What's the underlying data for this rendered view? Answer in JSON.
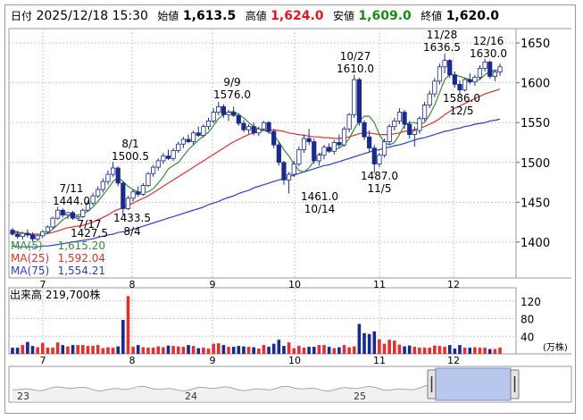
{
  "header": {
    "date_label": "日付",
    "datetime": "2025/12/18 15:30",
    "open_label": "始値",
    "open_value": "1,613.5",
    "high_label": "高値",
    "high_value": "1,624.0",
    "low_label": "安値",
    "low_value": "1,609.0",
    "close_label": "終値",
    "close_value": "1,620.0",
    "colors": {
      "high": "#e8141e",
      "low": "#1a8c1a",
      "text": "#000000"
    }
  },
  "ma_legend": [
    {
      "label": "MA(5)",
      "value": "1,615.20",
      "color": "#3a8a3a"
    },
    {
      "label": "MA(25)",
      "value": "1,592.04",
      "color": "#e03030"
    },
    {
      "label": "MA(75)",
      "value": "1,554.21",
      "color": "#2a3fd0"
    }
  ],
  "volume_label": "出来高",
  "volume_value": "219,700株",
  "volume_unit": "(万株)",
  "range_labels": [
    "23",
    "24",
    "25"
  ],
  "chart_data": {
    "type": "candlestick",
    "price_axis": {
      "ylim": [
        1355,
        1668
      ],
      "ticks": [
        1400,
        1450,
        1500,
        1550,
        1600,
        1650
      ]
    },
    "volume_axis": {
      "ylim": [
        0,
        150
      ],
      "ticks": [
        40,
        80,
        120
      ],
      "unit": "(万株)"
    },
    "month_labels": [
      "7",
      "8",
      "9",
      "10",
      "11",
      "12"
    ],
    "annotations": [
      {
        "date": "7/11",
        "price": "1444.0",
        "kind": "high"
      },
      {
        "date": "7/17",
        "price": "1427.5",
        "kind": "low"
      },
      {
        "date": "8/1",
        "price": "1500.5",
        "kind": "high"
      },
      {
        "date": "8/4",
        "price": "1433.5",
        "kind": "low"
      },
      {
        "date": "9/9",
        "price": "1576.0",
        "kind": "high"
      },
      {
        "date": "10/14",
        "price": "1461.0",
        "kind": "low"
      },
      {
        "date": "10/27",
        "price": "1610.0",
        "kind": "high"
      },
      {
        "date": "11/5",
        "price": "1487.0",
        "kind": "low"
      },
      {
        "date": "11/28",
        "price": "1636.5",
        "kind": "high"
      },
      {
        "date": "12/5",
        "price": "1586.0",
        "kind": "low"
      },
      {
        "date": "12/16",
        "price": "1630.0",
        "kind": "high"
      }
    ],
    "candles": [
      [
        1415,
        1418,
        1408,
        1410
      ],
      [
        1410,
        1414,
        1404,
        1407
      ],
      [
        1407,
        1413,
        1403,
        1411
      ],
      [
        1411,
        1416,
        1406,
        1409
      ],
      [
        1409,
        1412,
        1401,
        1404
      ],
      [
        1404,
        1410,
        1401,
        1408
      ],
      [
        1408,
        1415,
        1405,
        1413
      ],
      [
        1413,
        1421,
        1410,
        1419
      ],
      [
        1419,
        1432,
        1417,
        1430
      ],
      [
        1430,
        1444,
        1428,
        1440
      ],
      [
        1440,
        1442,
        1431,
        1434
      ],
      [
        1434,
        1438,
        1429,
        1437
      ],
      [
        1437,
        1439,
        1428,
        1430
      ],
      [
        1430,
        1433,
        1427.5,
        1432
      ],
      [
        1432,
        1442,
        1430,
        1440
      ],
      [
        1440,
        1452,
        1438,
        1449
      ],
      [
        1449,
        1462,
        1446,
        1458
      ],
      [
        1458,
        1470,
        1455,
        1466
      ],
      [
        1466,
        1480,
        1462,
        1476
      ],
      [
        1476,
        1490,
        1472,
        1485
      ],
      [
        1485,
        1500.5,
        1482,
        1493
      ],
      [
        1493,
        1495,
        1470,
        1474
      ],
      [
        1474,
        1476,
        1433.5,
        1442
      ],
      [
        1442,
        1458,
        1440,
        1455
      ],
      [
        1455,
        1466,
        1451,
        1463
      ],
      [
        1463,
        1470,
        1457,
        1460
      ],
      [
        1460,
        1474,
        1458,
        1471
      ],
      [
        1471,
        1488,
        1469,
        1486
      ],
      [
        1486,
        1497,
        1482,
        1494
      ],
      [
        1494,
        1505,
        1490,
        1502
      ],
      [
        1502,
        1512,
        1498,
        1508
      ],
      [
        1508,
        1516,
        1503,
        1505
      ],
      [
        1505,
        1518,
        1502,
        1515
      ],
      [
        1515,
        1526,
        1512,
        1523
      ],
      [
        1523,
        1532,
        1518,
        1529
      ],
      [
        1529,
        1535,
        1524,
        1526
      ],
      [
        1526,
        1540,
        1522,
        1537
      ],
      [
        1537,
        1545,
        1532,
        1534
      ],
      [
        1534,
        1548,
        1531,
        1545
      ],
      [
        1545,
        1556,
        1541,
        1552
      ],
      [
        1552,
        1568,
        1549,
        1563
      ],
      [
        1563,
        1576,
        1559,
        1570
      ],
      [
        1570,
        1573,
        1556,
        1560
      ],
      [
        1560,
        1566,
        1552,
        1563
      ],
      [
        1563,
        1570,
        1557,
        1559
      ],
      [
        1559,
        1562,
        1546,
        1549
      ],
      [
        1549,
        1553,
        1538,
        1541
      ],
      [
        1541,
        1548,
        1536,
        1545
      ],
      [
        1545,
        1550,
        1534,
        1537
      ],
      [
        1537,
        1545,
        1533,
        1542
      ],
      [
        1542,
        1552,
        1540,
        1550
      ],
      [
        1550,
        1552,
        1536,
        1539
      ],
      [
        1539,
        1542,
        1518,
        1522
      ],
      [
        1522,
        1526,
        1496,
        1500
      ],
      [
        1500,
        1502,
        1472,
        1478
      ],
      [
        1478,
        1488,
        1461,
        1485
      ],
      [
        1485,
        1502,
        1482,
        1498
      ],
      [
        1498,
        1520,
        1495,
        1516
      ],
      [
        1516,
        1535,
        1512,
        1530
      ],
      [
        1530,
        1542,
        1522,
        1526
      ],
      [
        1526,
        1530,
        1498,
        1502
      ],
      [
        1502,
        1512,
        1496,
        1509
      ],
      [
        1509,
        1522,
        1504,
        1519
      ],
      [
        1519,
        1524,
        1512,
        1514
      ],
      [
        1514,
        1528,
        1510,
        1525
      ],
      [
        1525,
        1535,
        1518,
        1522
      ],
      [
        1522,
        1545,
        1520,
        1542
      ],
      [
        1542,
        1562,
        1538,
        1560
      ],
      [
        1560,
        1610,
        1556,
        1604
      ],
      [
        1604,
        1606,
        1546,
        1550
      ],
      [
        1550,
        1553,
        1528,
        1532
      ],
      [
        1532,
        1540,
        1512,
        1518
      ],
      [
        1518,
        1522,
        1487,
        1498
      ],
      [
        1498,
        1512,
        1494,
        1509
      ],
      [
        1509,
        1530,
        1506,
        1526
      ],
      [
        1526,
        1548,
        1522,
        1545
      ],
      [
        1545,
        1556,
        1540,
        1552
      ],
      [
        1552,
        1568,
        1548,
        1563
      ],
      [
        1563,
        1566,
        1542,
        1548
      ],
      [
        1548,
        1552,
        1530,
        1535
      ],
      [
        1535,
        1545,
        1520,
        1540
      ],
      [
        1540,
        1558,
        1536,
        1555
      ],
      [
        1555,
        1576,
        1552,
        1572
      ],
      [
        1572,
        1590,
        1568,
        1586
      ],
      [
        1586,
        1606,
        1582,
        1602
      ],
      [
        1602,
        1624,
        1598,
        1620
      ],
      [
        1620,
        1636.5,
        1612,
        1628
      ],
      [
        1628,
        1630,
        1606,
        1610
      ],
      [
        1610,
        1614,
        1594,
        1598
      ],
      [
        1598,
        1603,
        1586,
        1591
      ],
      [
        1591,
        1606,
        1589,
        1604
      ],
      [
        1604,
        1612,
        1598,
        1601
      ],
      [
        1601,
        1610,
        1596,
        1607
      ],
      [
        1607,
        1622,
        1604,
        1618
      ],
      [
        1618,
        1630,
        1614,
        1626
      ],
      [
        1626,
        1628,
        1605,
        1608
      ],
      [
        1608,
        1616,
        1602,
        1613.5
      ],
      [
        1613.5,
        1624,
        1609,
        1620
      ]
    ],
    "ma5": [
      1414,
      1413,
      1411,
      1410,
      1408,
      1407,
      1409,
      1411,
      1416,
      1422,
      1428,
      1432,
      1434,
      1434,
      1435,
      1439,
      1444,
      1451,
      1459,
      1467,
      1476,
      1481,
      1476,
      1470,
      1466,
      1463,
      1462,
      1463,
      1467,
      1474,
      1482,
      1492,
      1496,
      1500,
      1508,
      1516,
      1522,
      1528,
      1533,
      1538,
      1546,
      1555,
      1560,
      1563,
      1564,
      1560,
      1556,
      1550,
      1545,
      1542,
      1540,
      1538,
      1534,
      1526,
      1516,
      1508,
      1498,
      1490,
      1488,
      1493,
      1502,
      1509,
      1514,
      1516,
      1516,
      1518,
      1522,
      1530,
      1542,
      1552,
      1558,
      1558,
      1550,
      1535,
      1525,
      1522,
      1525,
      1535,
      1547,
      1550,
      1550,
      1548,
      1550,
      1560,
      1572,
      1588,
      1604,
      1610,
      1610,
      1608,
      1606,
      1604,
      1602,
      1604,
      1610,
      1614,
      1616,
      1615.2
    ],
    "ma25": [
      1412,
      1412,
      1411,
      1411,
      1410,
      1410,
      1410,
      1411,
      1412,
      1414,
      1416,
      1418,
      1419,
      1420,
      1421,
      1423,
      1425,
      1428,
      1431,
      1434,
      1438,
      1441,
      1443,
      1446,
      1449,
      1452,
      1455,
      1458,
      1462,
      1466,
      1470,
      1474,
      1478,
      1482,
      1486,
      1490,
      1494,
      1498,
      1502,
      1506,
      1510,
      1514,
      1518,
      1522,
      1526,
      1529,
      1532,
      1535,
      1537,
      1539,
      1540,
      1541,
      1541,
      1540,
      1539,
      1537,
      1536,
      1535,
      1534,
      1533,
      1532,
      1532,
      1531,
      1531,
      1530,
      1530,
      1531,
      1532,
      1534,
      1536,
      1537,
      1537,
      1536,
      1535,
      1535,
      1535,
      1536,
      1537,
      1539,
      1540,
      1541,
      1543,
      1545,
      1548,
      1551,
      1555,
      1560,
      1564,
      1568,
      1571,
      1574,
      1577,
      1580,
      1583,
      1586,
      1588,
      1590,
      1592.04
    ],
    "ma75": [
      1395,
      1394,
      1394,
      1394,
      1394,
      1394,
      1395,
      1395,
      1396,
      1397,
      1398,
      1399,
      1400,
      1401,
      1402,
      1403,
      1404,
      1406,
      1407,
      1409,
      1410,
      1412,
      1413,
      1414,
      1416,
      1418,
      1420,
      1422,
      1424,
      1426,
      1428,
      1430,
      1432,
      1434,
      1436,
      1438,
      1440,
      1442,
      1444,
      1447,
      1449,
      1451,
      1454,
      1456,
      1458,
      1461,
      1463,
      1465,
      1468,
      1470,
      1472,
      1474,
      1476,
      1478,
      1480,
      1482,
      1484,
      1486,
      1488,
      1490,
      1492,
      1494,
      1496,
      1497,
      1499,
      1501,
      1503,
      1505,
      1507,
      1509,
      1511,
      1513,
      1515,
      1516,
      1518,
      1519,
      1521,
      1522,
      1524,
      1526,
      1528,
      1530,
      1531,
      1533,
      1535,
      1537,
      1539,
      1540,
      1542,
      1543,
      1545,
      1546,
      1548,
      1549,
      1550,
      1552,
      1553,
      1554.21
    ],
    "volumes": [
      14,
      14,
      20,
      27,
      18,
      15,
      25,
      14,
      14,
      26,
      20,
      17,
      20,
      20,
      20,
      18,
      18,
      20,
      13,
      15,
      14,
      17,
      77,
      131,
      16,
      20,
      15,
      14,
      14,
      17,
      15,
      19,
      18,
      17,
      16,
      20,
      18,
      13,
      14,
      12,
      23,
      24,
      20,
      16,
      16,
      18,
      17,
      16,
      15,
      12,
      20,
      16,
      23,
      32,
      18,
      26,
      13,
      18,
      14,
      16,
      16,
      20,
      20,
      16,
      13,
      15,
      20,
      15,
      17,
      68,
      47,
      45,
      51,
      33,
      23,
      32,
      30,
      21,
      17,
      19,
      16,
      14,
      14,
      14,
      19,
      18,
      16,
      20,
      12,
      20,
      14,
      14,
      15,
      14,
      14,
      11,
      11,
      14
    ]
  }
}
